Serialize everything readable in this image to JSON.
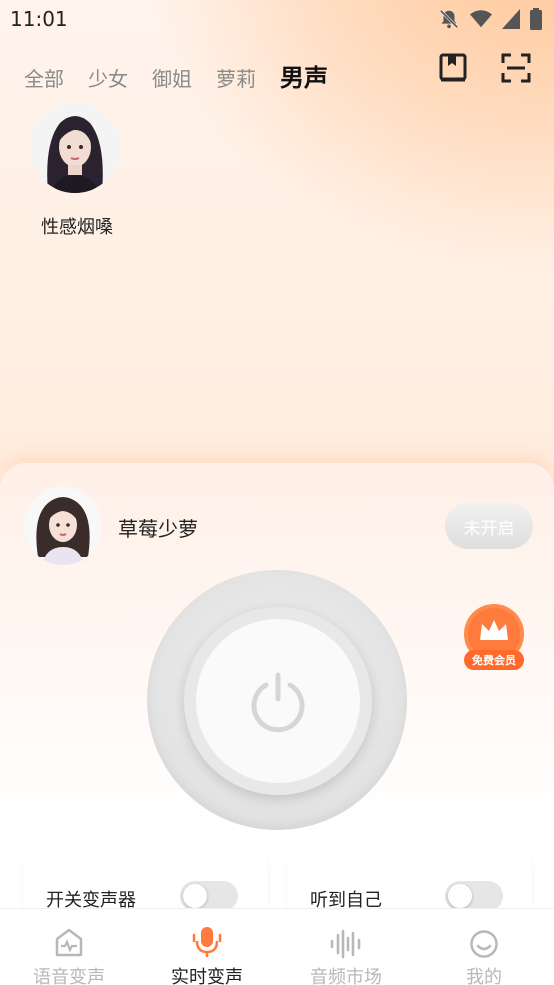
{
  "status_bar": {
    "time": "11:01"
  },
  "tabs": [
    {
      "label": "全部"
    },
    {
      "label": "少女"
    },
    {
      "label": "御姐"
    },
    {
      "label": "萝莉"
    },
    {
      "label": "男声",
      "active": true
    }
  ],
  "voices": [
    {
      "name": "性感烟嗓"
    }
  ],
  "current_voice": {
    "name": "草莓少萝",
    "state_label": "未开启"
  },
  "vip_badge": {
    "label": "免费会员"
  },
  "options": [
    {
      "label": "开关变声器",
      "on": false
    },
    {
      "label": "听到自己",
      "on": false
    }
  ],
  "nav": [
    {
      "label": "语音变声",
      "icon": "voice-change-icon"
    },
    {
      "label": "实时变声",
      "icon": "microphone-icon",
      "active": true
    },
    {
      "label": "音频市场",
      "icon": "waveform-icon"
    },
    {
      "label": "我的",
      "icon": "smile-icon"
    }
  ],
  "colors": {
    "accent": "#ff7a3d",
    "inactive": "#b8b8b8"
  }
}
